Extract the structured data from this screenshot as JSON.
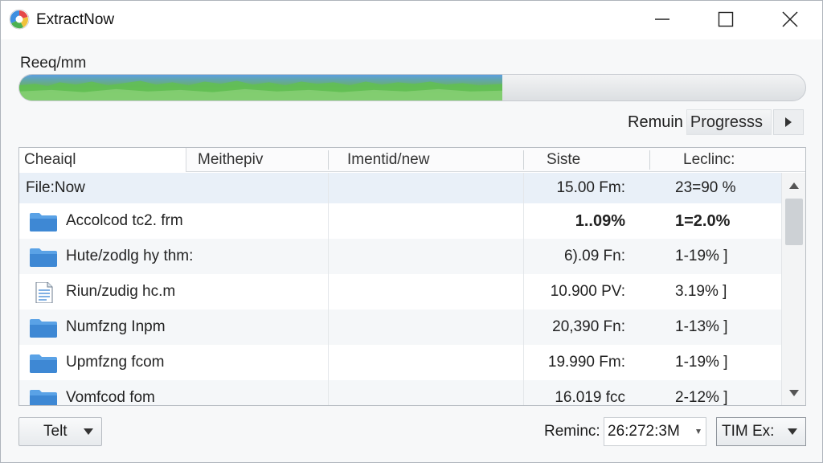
{
  "window": {
    "title": "ExtractNow"
  },
  "progress": {
    "label": "Reeq/mm",
    "fraction": 0.615
  },
  "remain_progress": {
    "label": "Remuin",
    "button_label": "Progresss"
  },
  "list": {
    "columns": [
      "Cheaiql",
      "Meithepiv",
      "Imentid/new",
      "Siste",
      "Leclinc:"
    ],
    "rows": [
      {
        "name": "File:Now",
        "size": "15.00 Fm:",
        "decline": "23=90 %",
        "icon": "",
        "selected": true,
        "bold": false
      },
      {
        "name": "Accolcod tc2. frm",
        "size": "1..09%",
        "decline": "1=2.0%",
        "icon": "folder-icon",
        "selected": false,
        "bold": true
      },
      {
        "name": "Hute/zodlg hy thm:",
        "size": "6).09 Fn:",
        "decline": "1-19% ]",
        "icon": "folder-icon",
        "selected": false,
        "bold": false
      },
      {
        "name": "Riun/zudig hc.m",
        "size": "10.900 PV:",
        "decline": "3.19% ]",
        "icon": "document-icon",
        "selected": false,
        "bold": false
      },
      {
        "name": "Numfzng Inpm",
        "size": "20,390 Fn:",
        "decline": "1-13% ]",
        "icon": "folder-icon",
        "selected": false,
        "bold": false
      },
      {
        "name": "Upmfzng fcom",
        "size": "19.990 Fm:",
        "decline": "1-19% ]",
        "icon": "folder-icon",
        "selected": false,
        "bold": false
      },
      {
        "name": "Vomfcod fom",
        "size": "16.019 fcc",
        "decline": "2-12% ]",
        "icon": "folder-icon",
        "selected": false,
        "bold": false
      }
    ]
  },
  "footer": {
    "left_button": "Telt",
    "remain_label": "Reminc:",
    "remain_value": "26:272:3M",
    "tim_value": "TIM Ex:"
  },
  "colors": {
    "accent_blue": "#5c9ee0",
    "progress_green": "#6ec65a",
    "selection": "#e9f0f8"
  }
}
